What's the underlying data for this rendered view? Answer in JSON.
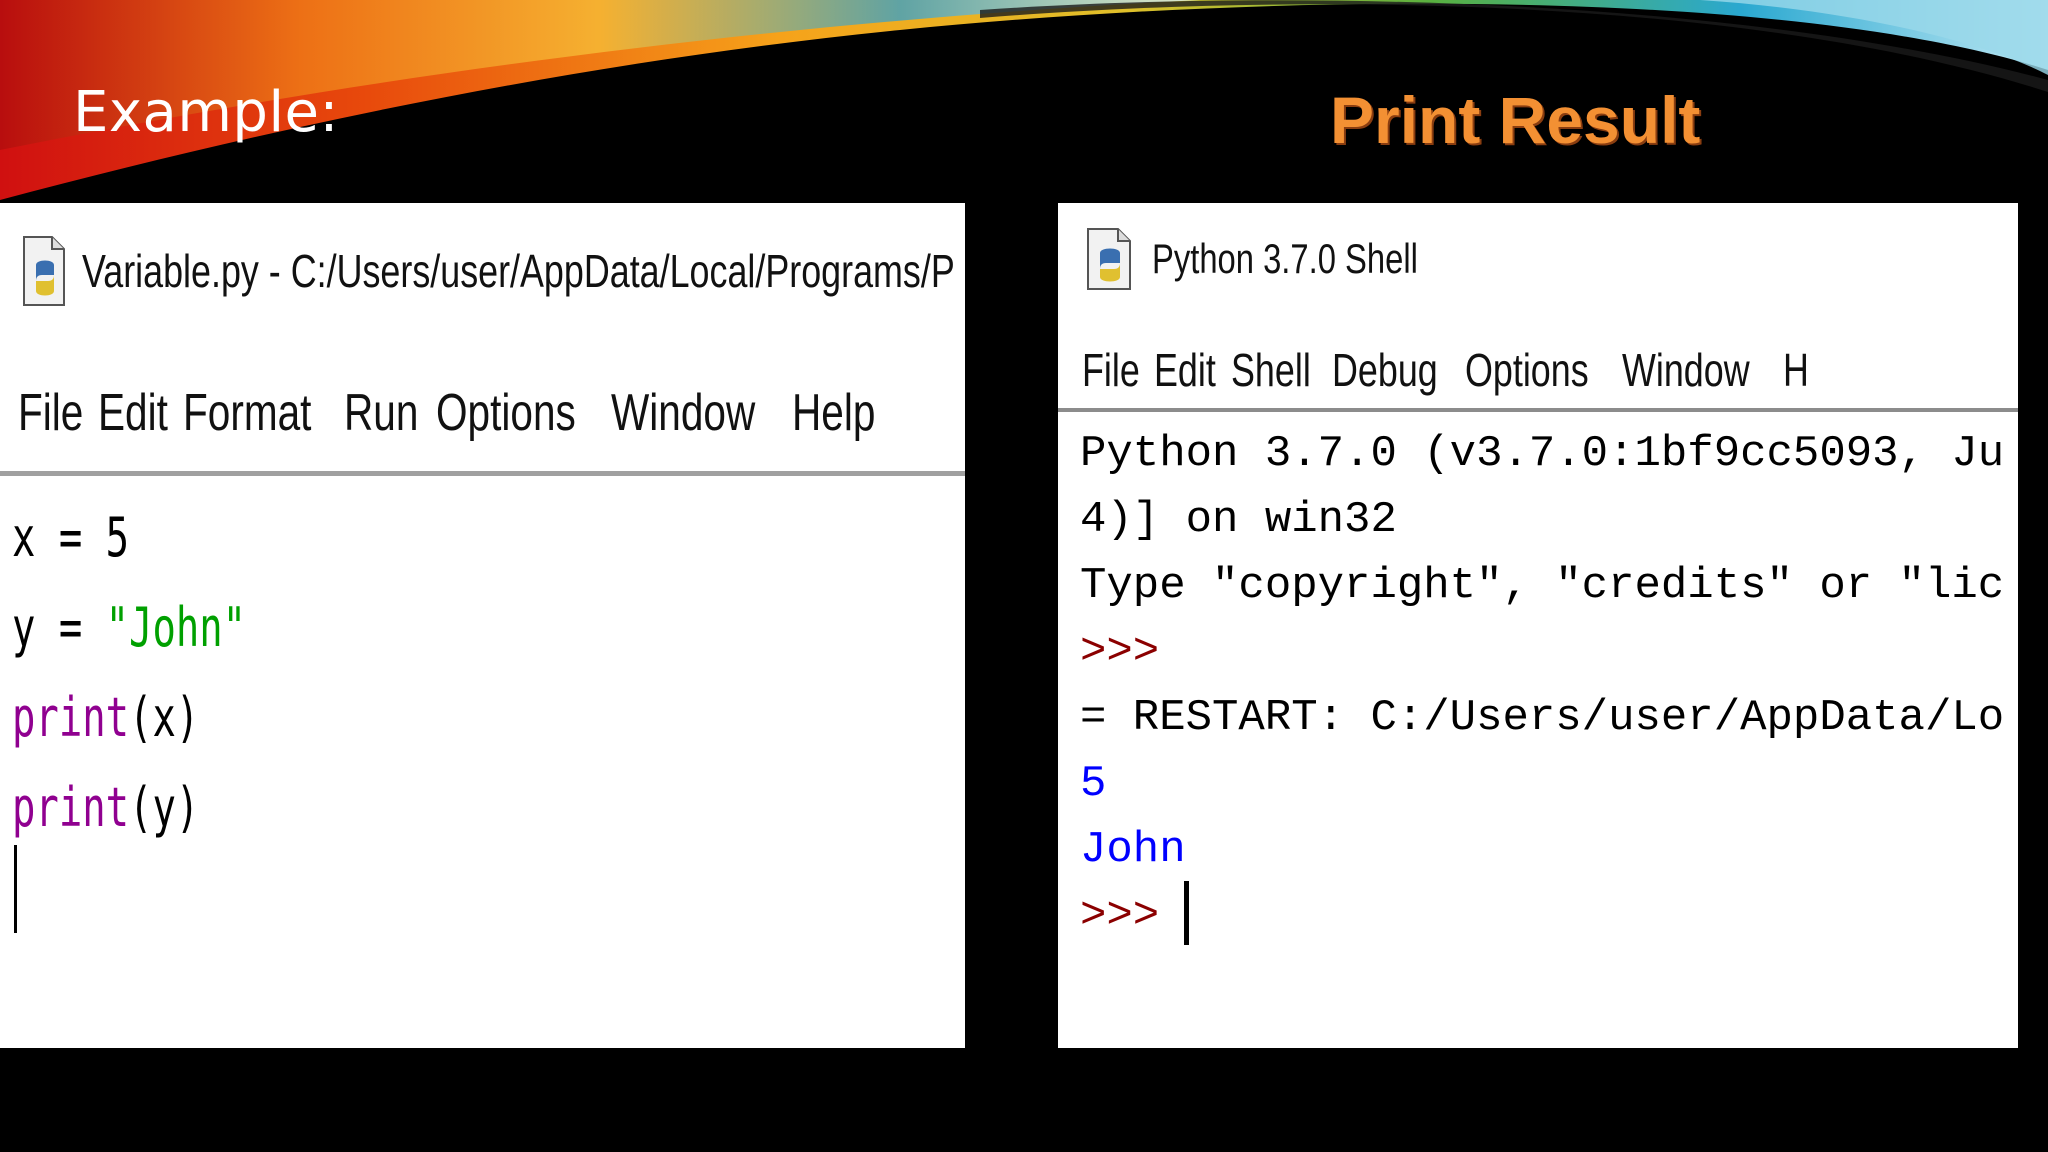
{
  "slide": {
    "title": "Example:",
    "result_title": "Print Result"
  },
  "editor": {
    "title": "Variable.py - C:/Users/user/AppData/Local/Programs/P",
    "menu": [
      "File",
      "Edit",
      "Format",
      "Run",
      "Options",
      "Window",
      "Help"
    ],
    "code": {
      "line1": "x = 5",
      "line2_prefix": "y = ",
      "line2_string": "\"John\"",
      "line3_keyword": "print",
      "line3_args": "(x)",
      "line4_keyword": "print",
      "line4_args": "(y)"
    }
  },
  "shell": {
    "title": "Python 3.7.0 Shell",
    "menu": [
      "File",
      "Edit",
      "Shell",
      "Debug",
      "Options",
      "Window",
      "H"
    ],
    "lines": {
      "banner1": "Python 3.7.0 (v3.7.0:1bf9cc5093, Ju",
      "banner2": "4)] on win32",
      "banner3": "Type \"copyright\", \"credits\" or \"lic",
      "prompt1": ">>>",
      "restart": "= RESTART: C:/Users/user/AppData/Lo",
      "output1": "5",
      "output2": "John",
      "prompt2": ">>>"
    }
  },
  "colors": {
    "keyword": "#900090",
    "string": "#00a000",
    "output": "#0000ff",
    "prompt": "#8b0000",
    "result_title": "#f39033"
  },
  "icons": {
    "editor_icon": "python-file-icon",
    "shell_icon": "python-file-icon"
  }
}
